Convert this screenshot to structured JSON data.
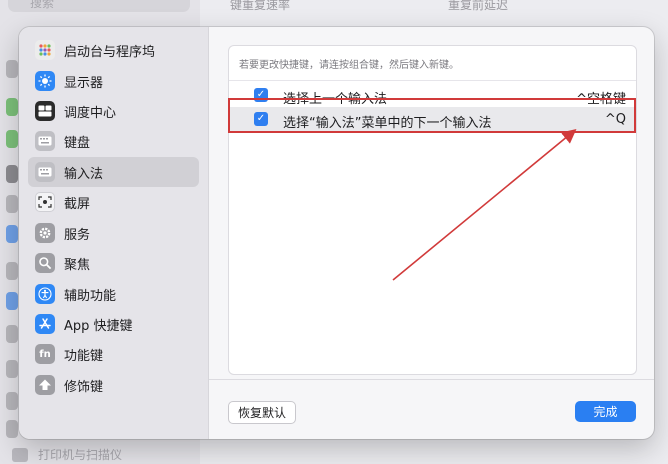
{
  "background": {
    "search_placeholder": "搜索",
    "col1_label": "键重复速率",
    "col2_label": "重复前延迟",
    "bottom_item_label": "打印机与扫描仪"
  },
  "sidebar": {
    "items": [
      {
        "label": "启动台与程序坞",
        "icon": "launchpad-dock-icon",
        "color": "#ececec"
      },
      {
        "label": "显示器",
        "icon": "display-icon",
        "color": "#2f88f5"
      },
      {
        "label": "调度中心",
        "icon": "mission-control-icon",
        "color": "#2b2b2b"
      },
      {
        "label": "键盘",
        "icon": "keyboard-icon",
        "color": "#bfbfc4"
      },
      {
        "label": "输入法",
        "icon": "input-source-icon",
        "color": "#bfbfc4"
      },
      {
        "label": "截屏",
        "icon": "screenshot-icon",
        "color": "#bfbfc4"
      },
      {
        "label": "服务",
        "icon": "services-gear-icon",
        "color": "#9e9ea3"
      },
      {
        "label": "聚焦",
        "icon": "spotlight-icon",
        "color": "#9e9ea3"
      },
      {
        "label": "辅助功能",
        "icon": "accessibility-icon",
        "color": "#2f88f5"
      },
      {
        "label": "App 快捷键",
        "icon": "app-store-icon",
        "color": "#2f88f5"
      },
      {
        "label": "功能键",
        "icon": "fn-key-icon",
        "color": "#9e9ea3"
      },
      {
        "label": "修饰键",
        "icon": "modifier-key-icon",
        "color": "#9e9ea3"
      }
    ],
    "selected_index": 4
  },
  "panel": {
    "hint": "若要更改快捷键，请连按组合键，然后键入新键。",
    "rows": [
      {
        "label": "选择上一个输入法",
        "shortcut": "^空格键",
        "checked": true
      },
      {
        "label": "选择“输入法”菜单中的下一个输入法",
        "shortcut": "^Q",
        "checked": true
      }
    ]
  },
  "buttons": {
    "restore_defaults": "恢复默认",
    "done": "完成"
  },
  "colors": {
    "accent": "#2a7ff2",
    "annotation": "#d13a3a"
  }
}
